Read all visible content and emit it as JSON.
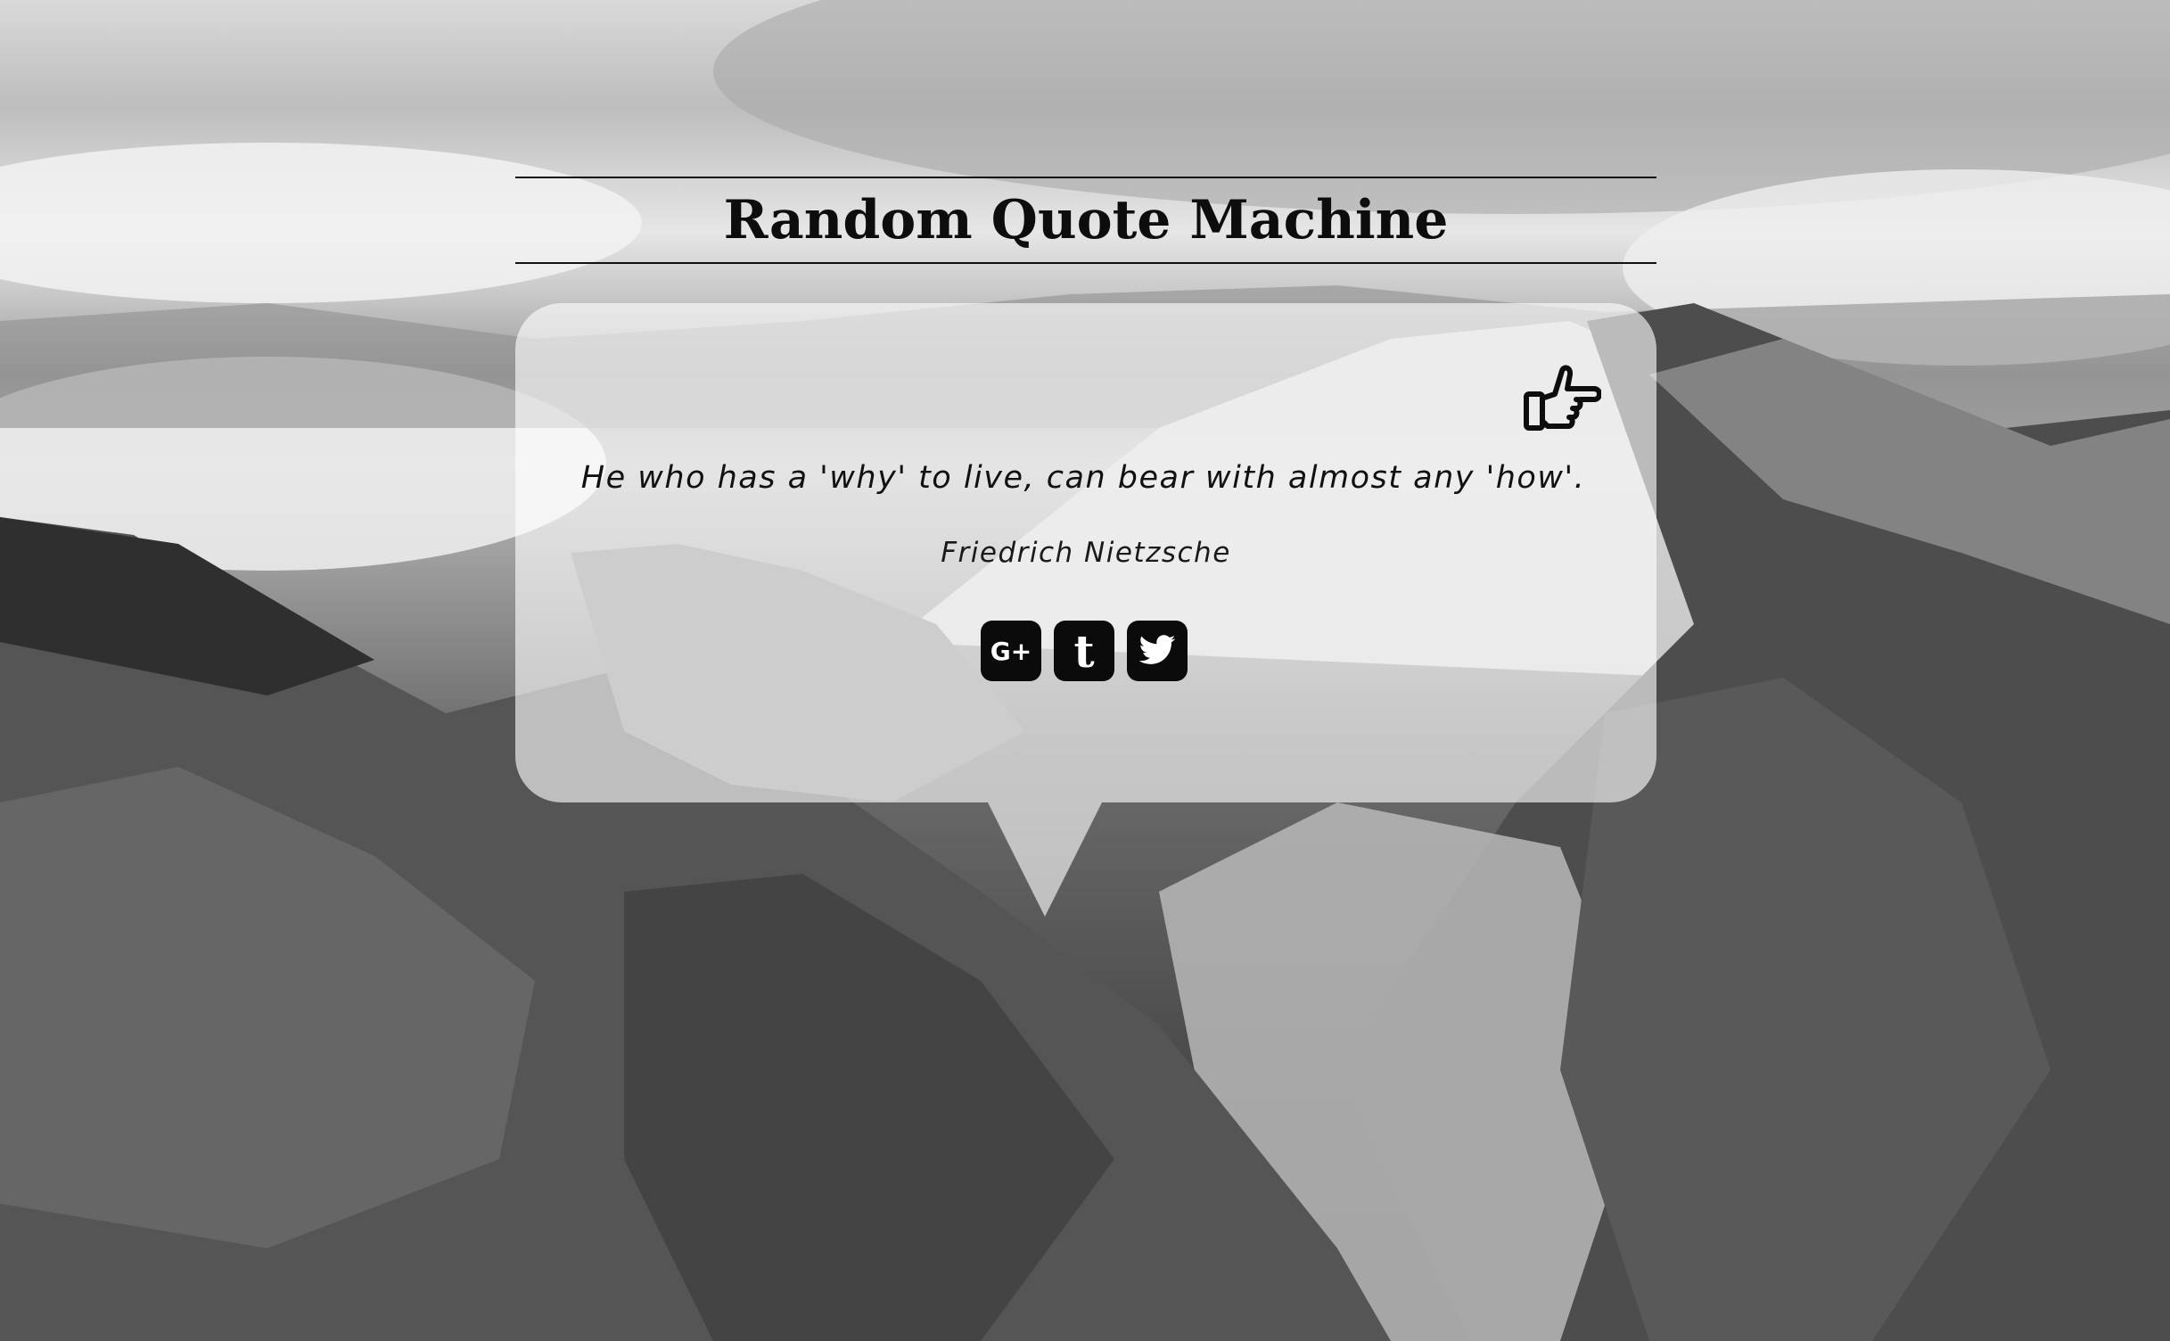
{
  "header": {
    "title": "Random Quote Machine"
  },
  "quote": {
    "text": "He who has a 'why' to live, can bear with almost any 'how'.",
    "author": "Friedrich Nietzsche"
  },
  "controls": {
    "next_icon": "hand-pointing-right-icon"
  },
  "share": {
    "items": [
      {
        "icon": "google-plus-icon",
        "glyph": "G+"
      },
      {
        "icon": "tumblr-icon",
        "glyph": "t"
      },
      {
        "icon": "twitter-icon",
        "glyph": ""
      }
    ]
  },
  "colors": {
    "text": "#0d0d0d",
    "bubble": "rgba(255,255,255,0.62)",
    "icon_bg": "#0b0b0b"
  }
}
